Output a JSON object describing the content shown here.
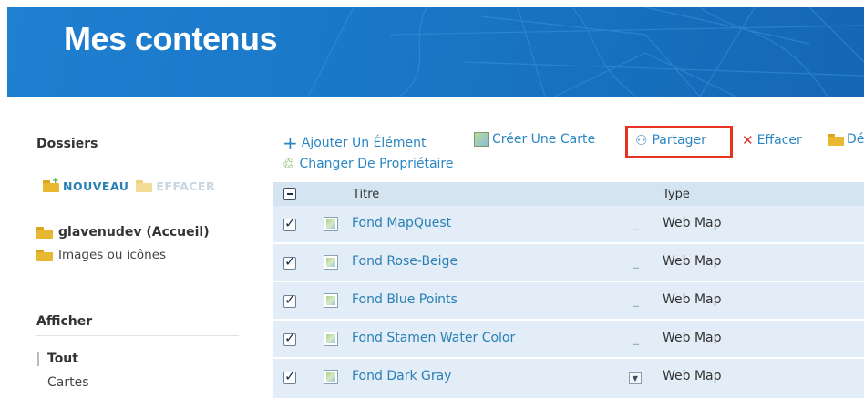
{
  "header": {
    "title": "Mes contenus"
  },
  "sidebar": {
    "folders_heading": "Dossiers",
    "new_label": "NOUVEAU",
    "delete_label": "EFFACER",
    "folders": [
      {
        "label": "glavenudev (Accueil)"
      },
      {
        "label": "Images ou icônes"
      }
    ],
    "show_heading": "Afficher",
    "filters": [
      {
        "label": "Tout"
      },
      {
        "label": "Cartes"
      }
    ]
  },
  "toolbar": {
    "add_item": "Ajouter Un Élément",
    "create_map": "Créer Une Carte",
    "share": "Partager",
    "delete": "Effacer",
    "move_partial": "Dé",
    "change_owner": "Changer De Propriétaire"
  },
  "table": {
    "columns": {
      "title": "Titre",
      "type": "Type"
    },
    "rows": [
      {
        "title": "Fond MapQuest",
        "type": "Web Map"
      },
      {
        "title": "Fond Rose-Beige",
        "type": "Web Map"
      },
      {
        "title": "Fond Blue Points",
        "type": "Web Map"
      },
      {
        "title": "Fond Stamen Water Color",
        "type": "Web Map"
      },
      {
        "title": "Fond Dark Gray",
        "type": "Web Map"
      }
    ]
  },
  "icons": {
    "add": "plus-icon",
    "create_map": "map-icon",
    "share": "share-icon",
    "delete": "close-icon",
    "move": "folder-icon",
    "change_owner": "user-change-icon"
  },
  "colors": {
    "banner": "#1a78c8",
    "link": "#2a7fb4",
    "highlight_box": "#e63322",
    "row_bg": "#e2edf7",
    "header_bg": "#d4e4f1"
  }
}
